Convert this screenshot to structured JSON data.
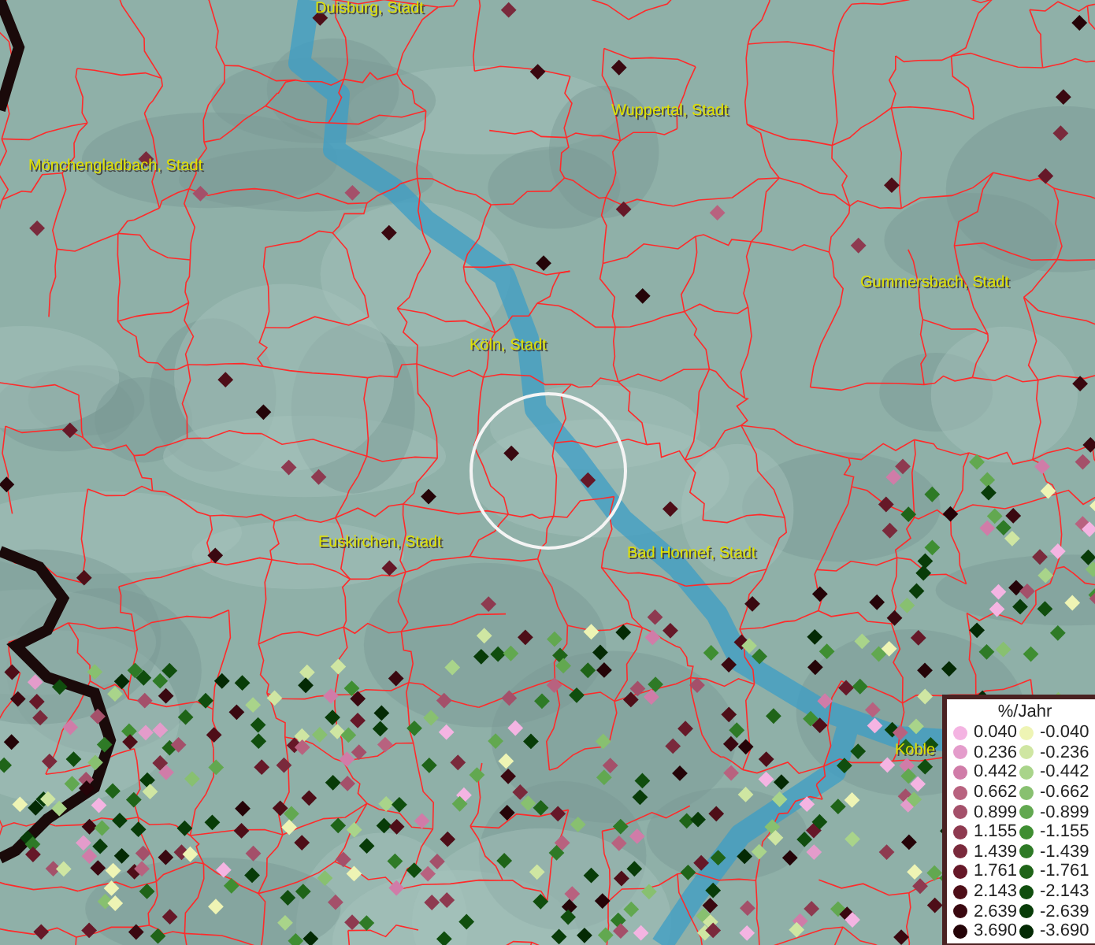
{
  "map": {
    "labels": [
      {
        "text": "Duisburg, Stadt"
      },
      {
        "text": "Wuppertal, Stadt"
      },
      {
        "text": "Mönchengladbach, Stadt"
      },
      {
        "text": "Gummersbach, Stadt"
      },
      {
        "text": "Köln, Stadt"
      },
      {
        "text": "Euskirchen, Stadt"
      },
      {
        "text": "Bad Honnef, Stadt"
      },
      {
        "text": "Koble"
      }
    ]
  },
  "legend": {
    "title": "%/Jahr",
    "entries": [
      {
        "label": "0.040",
        "color": "#f4b4e2"
      },
      {
        "label": "-0.040",
        "color": "#eef4b4"
      },
      {
        "label": "0.236",
        "color": "#e49ccb"
      },
      {
        "label": "-0.236",
        "color": "#cfe6a2"
      },
      {
        "label": "0.442",
        "color": "#d07ca8"
      },
      {
        "label": "-0.442",
        "color": "#a9d48a"
      },
      {
        "label": "0.662",
        "color": "#b8627f"
      },
      {
        "label": "-0.662",
        "color": "#88c070"
      },
      {
        "label": "0.899",
        "color": "#a4506a"
      },
      {
        "label": "-0.899",
        "color": "#62a850"
      },
      {
        "label": "1.155",
        "color": "#8e3a50"
      },
      {
        "label": "-1.155",
        "color": "#3f8e32"
      },
      {
        "label": "1.439",
        "color": "#7a2a3c"
      },
      {
        "label": "-1.439",
        "color": "#2e7a26"
      },
      {
        "label": "1.761",
        "color": "#661828"
      },
      {
        "label": "-1.761",
        "color": "#1f6418"
      },
      {
        "label": "2.143",
        "color": "#4e0e18"
      },
      {
        "label": "-2.143",
        "color": "#104e0e"
      },
      {
        "label": "2.639",
        "color": "#3a0810"
      },
      {
        "label": "-2.639",
        "color": "#083c08"
      },
      {
        "label": "3.690",
        "color": "#250408"
      },
      {
        "label": "-3.690",
        "color": "#042a04"
      }
    ]
  }
}
